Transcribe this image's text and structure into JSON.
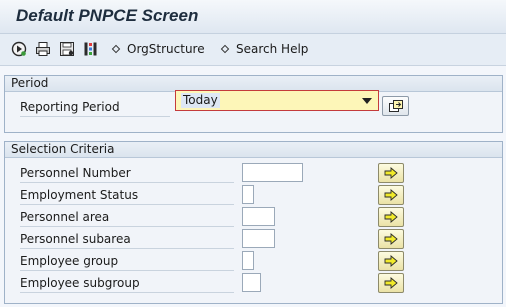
{
  "window": {
    "title": "Default PNPCE Screen"
  },
  "toolbar": {
    "icons": [
      "execute-icon",
      "print-icon",
      "save-variant-icon",
      "layout-icon"
    ],
    "orgstructure_label": "OrgStructure",
    "search_help_label": "Search Help"
  },
  "period": {
    "header": "Period",
    "reporting_period_label": "Reporting Period",
    "reporting_period_value": "Today"
  },
  "selection": {
    "header": "Selection Criteria",
    "fields": [
      {
        "label": "Personnel Number",
        "value": ""
      },
      {
        "label": "Employment Status",
        "value": ""
      },
      {
        "label": "Personnel area",
        "value": ""
      },
      {
        "label": "Personnel subarea",
        "value": ""
      },
      {
        "label": "Employee group",
        "value": ""
      },
      {
        "label": "Employee subgroup",
        "value": ""
      }
    ]
  },
  "colors": {
    "accent_red": "#c43b3b",
    "dropdown_bg": "#fdf6b8",
    "arrow_yellow": "#f1ea2a"
  }
}
